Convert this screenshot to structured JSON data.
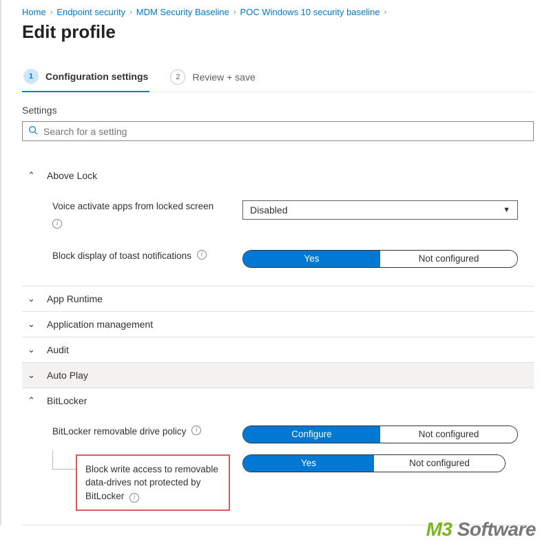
{
  "breadcrumb": {
    "items": [
      "Home",
      "Endpoint security",
      "MDM Security Baseline",
      "POC Windows 10 security baseline"
    ]
  },
  "page_title": "Edit profile",
  "stepper": {
    "steps": [
      {
        "num": "1",
        "label": "Configuration settings"
      },
      {
        "num": "2",
        "label": "Review + save"
      }
    ]
  },
  "settings_label": "Settings",
  "search": {
    "placeholder": "Search for a setting"
  },
  "sections": {
    "aboveLock": {
      "title": "Above Lock",
      "voice": {
        "label": "Voice activate apps from locked screen",
        "value": "Disabled"
      },
      "toast": {
        "label": "Block display of toast notifications",
        "opts": [
          "Yes",
          "Not configured"
        ]
      }
    },
    "appRuntime": {
      "title": "App Runtime"
    },
    "appMgmt": {
      "title": "Application management"
    },
    "audit": {
      "title": "Audit"
    },
    "autoPlay": {
      "title": "Auto Play"
    },
    "bitlocker": {
      "title": "BitLocker",
      "policy": {
        "label": "BitLocker removable drive policy",
        "opts": [
          "Configure",
          "Not configured"
        ]
      },
      "blockWrite": {
        "label": "Block write access to removable data-drives not protected by BitLocker",
        "opts": [
          "Yes",
          "Not configured"
        ]
      }
    }
  },
  "watermark": {
    "m3": "M3",
    "soft": " Software"
  }
}
